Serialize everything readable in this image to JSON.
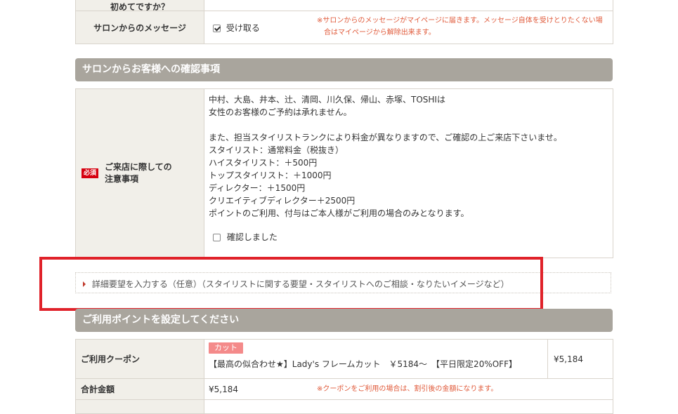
{
  "top_row_partial": {
    "label": "初めてですか？"
  },
  "message_row": {
    "label": "サロンからのメッセージ",
    "checkbox_label": "受け取る",
    "checked": true,
    "note_line1": "※サロンからのメッセージがマイページに届きます。メッセージ自体を受けとりたくない場",
    "note_line2": "合はマイページから解除出来ます。"
  },
  "confirm_section": {
    "heading": "サロンからお客様への確認事項",
    "required_badge": "必須",
    "row_label_line1": "ご来店に際しての",
    "row_label_line2": "注意事項",
    "lines": [
      "中村、大島、井本、辻、清岡、川久保、帰山、赤塚、TOSHIは",
      "女性のお客様のご予約は承れません。",
      "",
      "また、担当スタイリストランクにより料金が異なりますので、ご確認の上ご来店下さいませ。",
      "スタイリスト：通常料金（税抜き）",
      "ハイスタイリスト：＋500円",
      "トップスタイリスト：＋1000円",
      "ディレクター：＋1500円",
      "クリエイティブディレクター＋2500円",
      "ポイントのご利用、付与はご本人様がご利用の場合のみとなります。"
    ],
    "confirm_checkbox_label": "確認しました"
  },
  "detail_request": {
    "link_text": "詳細要望を入力する（任意）（スタイリストに関する要望・スタイリストへのご相談・なりたいイメージなど）"
  },
  "points_section": {
    "heading": "ご利用ポイントを設定してください"
  },
  "coupon_row": {
    "label": "ご利用クーポン",
    "tag": "カット",
    "description": "【最高の似合わせ★】Lady's フレームカット　￥5184～　【平日限定20%OFF】",
    "price": "¥5,184"
  },
  "total_row": {
    "label": "合計金額",
    "amount": "¥5,184",
    "note": "※クーポンをご利用の場合は、割引後の金額になります。"
  },
  "colors": {
    "header_bg": "#a9a59d",
    "label_bg": "#f1efe9",
    "required": "#d6000f",
    "highlight_box": "#e0222a",
    "note_text": "#e05a3a"
  }
}
